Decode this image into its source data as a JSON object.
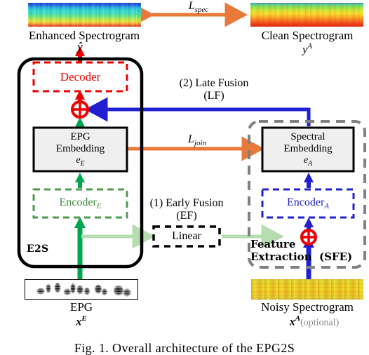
{
  "figure": {
    "caption": "Fig. 1.  Overall architecture of the EPG2S"
  },
  "top": {
    "enhanced_label": "Enhanced Spectrogram",
    "enhanced_symbol": "ŷ",
    "clean_label": "Clean Spectrogram",
    "clean_symbol": "y",
    "clean_symbol_sup": "A",
    "loss_spec": "L",
    "loss_spec_sub": "spec"
  },
  "model": {
    "e2s_label": "E2S",
    "decoder_label": "Decoder",
    "epg_embedding_line1": "EPG",
    "epg_embedding_line2": "Embedding",
    "epg_embedding_symbol": "e",
    "epg_embedding_symbol_sub": "E",
    "encoder_e_label": "Encoder",
    "encoder_e_sub": "E",
    "spectral_embedding_line1": "Spectral",
    "spectral_embedding_line2": "Embedding",
    "spectral_embedding_symbol": "e",
    "spectral_embedding_symbol_sub": "A",
    "encoder_a_label": "Encoder",
    "encoder_a_sub": "A",
    "linear_label": "Linear",
    "sfe_line1": "Feature",
    "sfe_line2": "Extraction",
    "sfe_acronym": "(SFE)"
  },
  "fusion": {
    "late_line1": "(2) Late Fusion",
    "late_line2": "(LF)",
    "early_line1": "(1) Early Fusion",
    "early_line2": "(EF)",
    "loss_join": "L",
    "loss_join_sub": "join"
  },
  "inputs": {
    "epg_label": "EPG",
    "epg_symbol": "x",
    "epg_symbol_sup": "E",
    "noisy_label": "Noisy Spectrogram",
    "noisy_symbol": "x",
    "noisy_symbol_sup": "A",
    "noisy_optional": "(optional)"
  },
  "icons": {
    "sum_operator": "plus-circle-icon"
  },
  "colors": {
    "red": "#ee0000",
    "green": "#00a550",
    "green_dark": "#2e8b3d",
    "green_pale": "#b5ddb0",
    "blue": "#2020d0",
    "orange": "#e8793a",
    "gray": "#808080",
    "black": "#000000"
  }
}
